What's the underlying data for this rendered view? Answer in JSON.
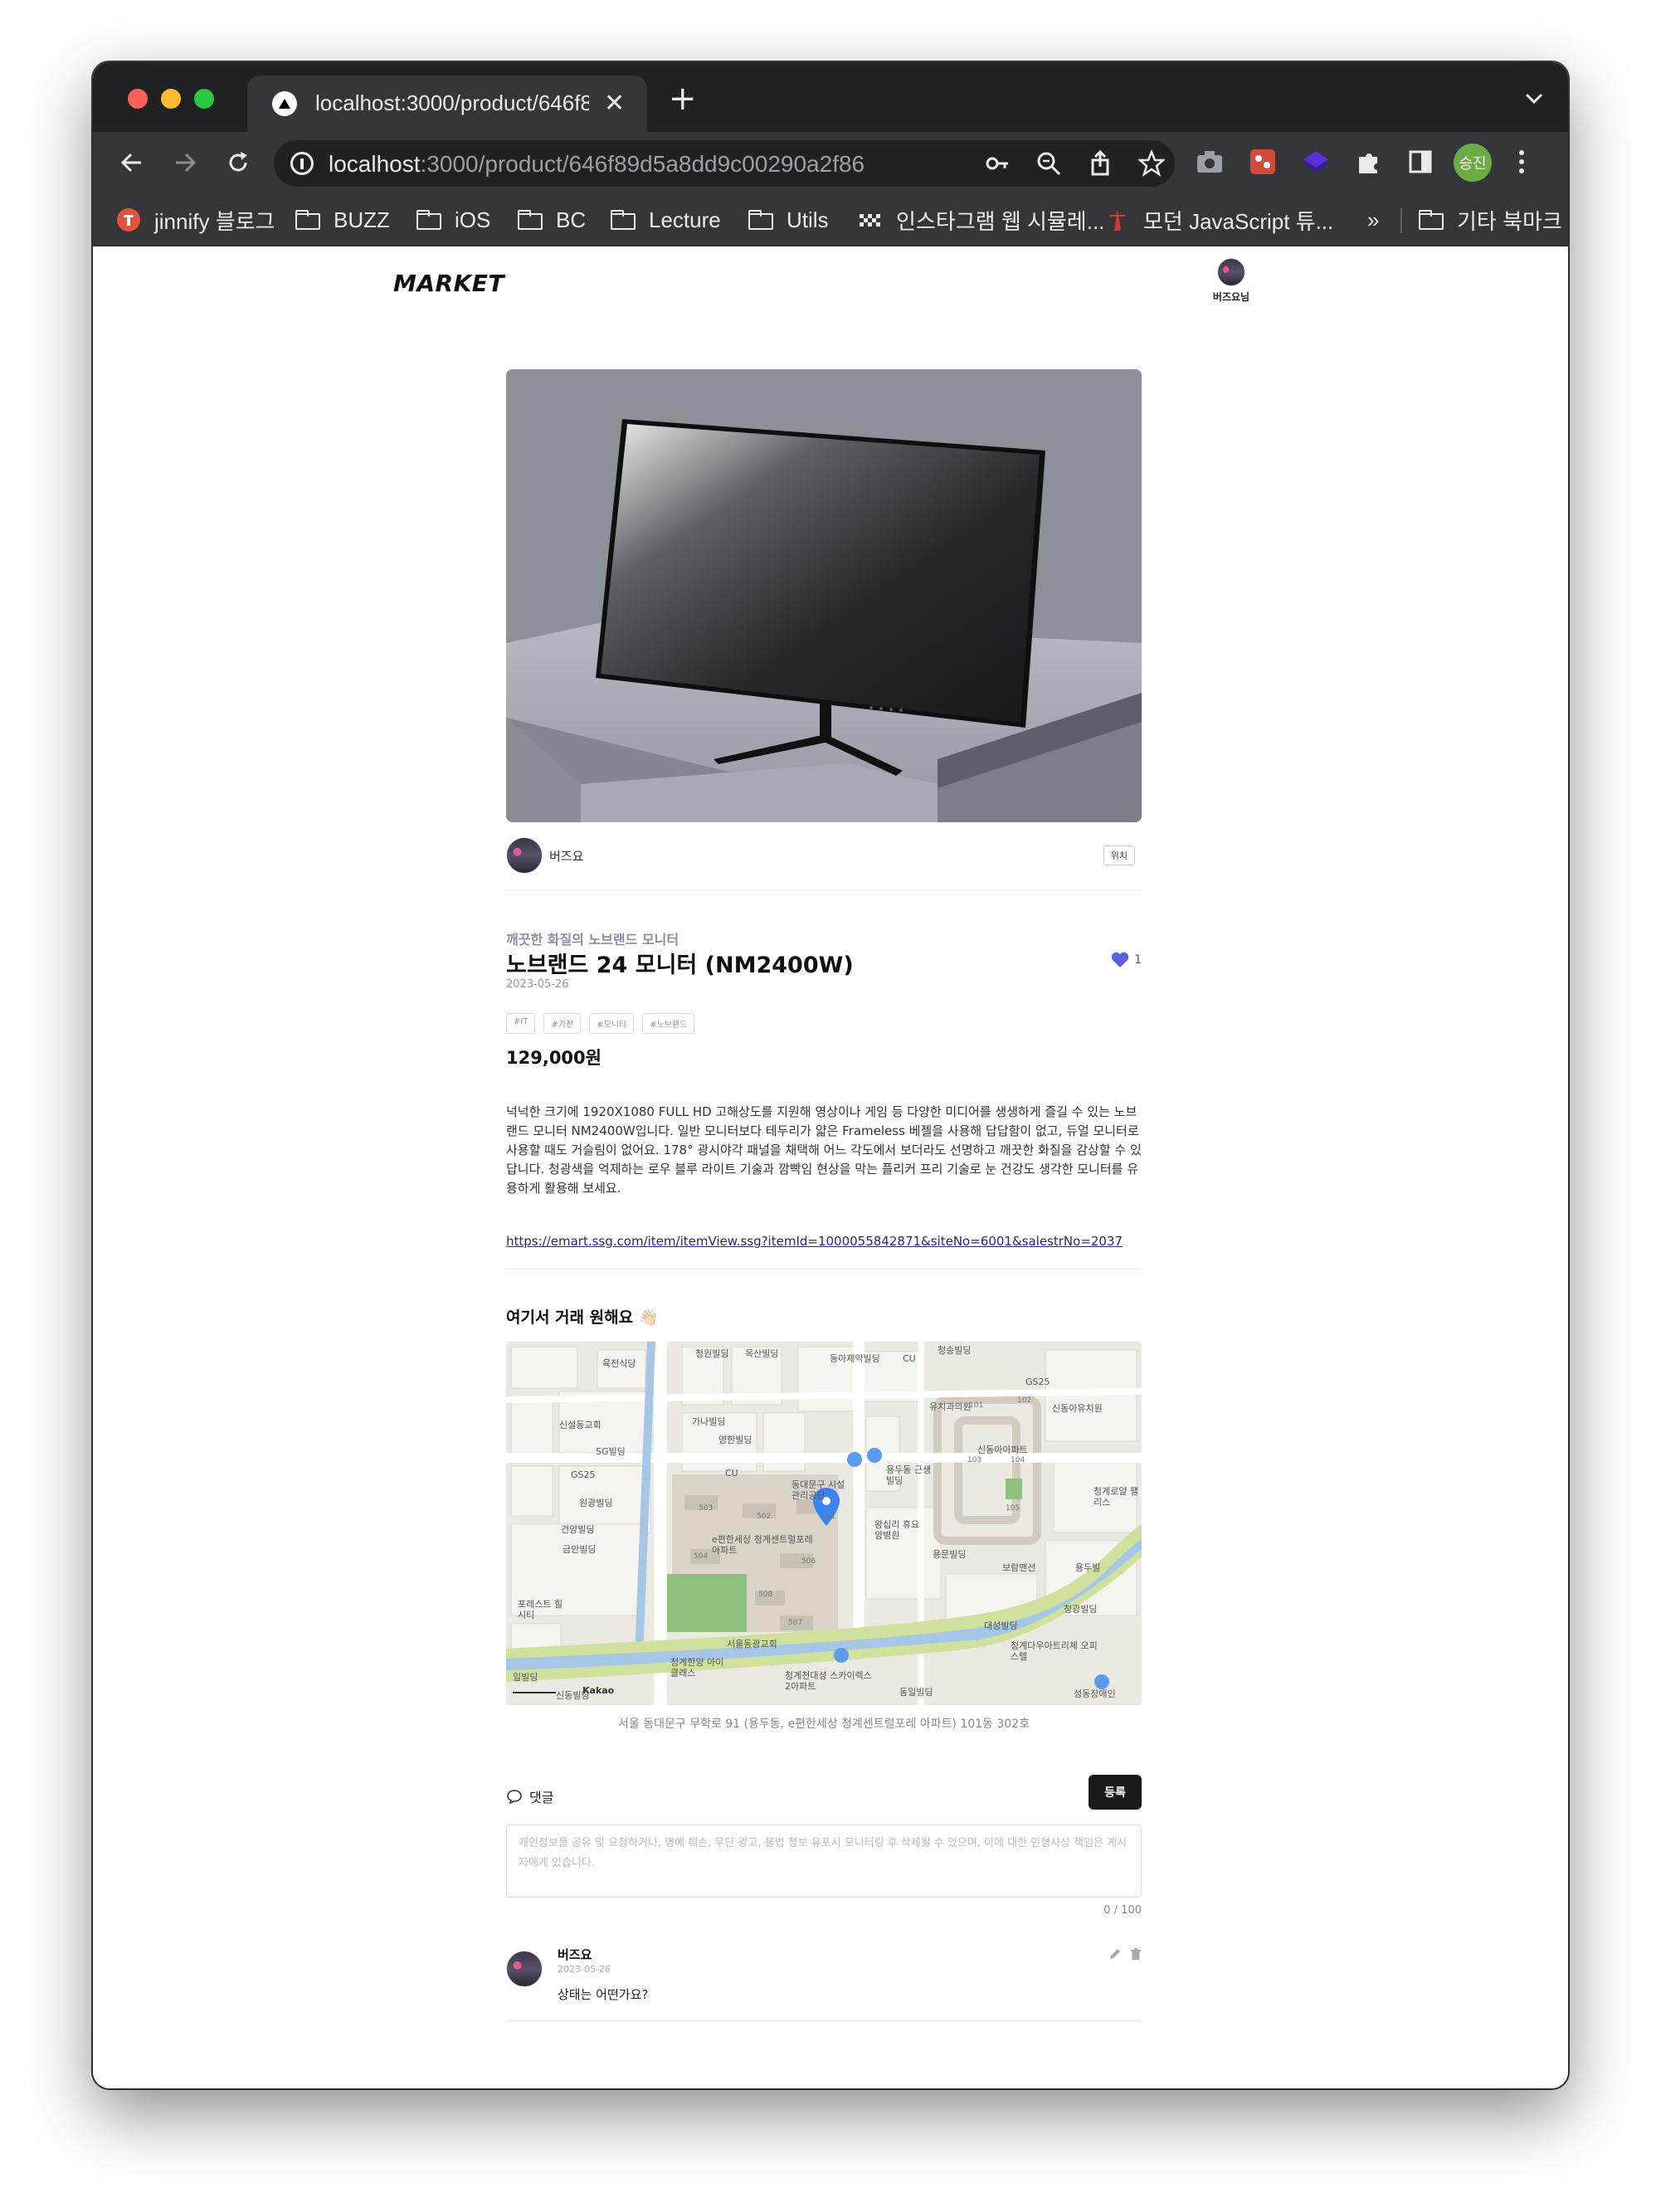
{
  "browser": {
    "tab_title": "localhost:3000/product/646f89d5a8dd9c00290a2f86",
    "url_host": "localhost",
    "url_path": ":3000/product/646f89d5a8dd9c00290a2f86",
    "profile_label": "승진",
    "bookmarks": [
      {
        "label": "jinnify 블로그",
        "icon": "jinnify-favicon"
      },
      {
        "label": "BUZZ",
        "icon": "folder-icon"
      },
      {
        "label": "iOS",
        "icon": "folder-icon"
      },
      {
        "label": "BC",
        "icon": "folder-icon"
      },
      {
        "label": "Lecture",
        "icon": "folder-icon"
      },
      {
        "label": "Utils",
        "icon": "folder-icon"
      },
      {
        "label": "인스타그램 웹 시뮬레...",
        "icon": "checker-favicon"
      },
      {
        "label": "모던 JavaScript 튜...",
        "icon": "tower-favicon"
      }
    ],
    "bookmarks_overflow": "»",
    "other_bookmarks": "기타 북마크"
  },
  "header": {
    "logo": "MARKET",
    "user_name": "버즈요님"
  },
  "product": {
    "seller_name": "버즈요",
    "location_button": "위치",
    "subtitle": "깨끗한 화질의 노브랜드 모니터",
    "title": "노브랜드 24 모니터 (NM2400W)",
    "like_count": "1",
    "date": "2023-05-26",
    "tags": [
      "#IT",
      "#가전",
      "#모니터",
      "#노브랜드"
    ],
    "price": "129,000원",
    "description": "넉넉한 크기에 1920X1080 FULL HD 고해상도를 지원해 영상이나 게임 등 다양한 미디어를 생생하게 즐길 수 있는 노브랜드 모니터 NM2400W입니다. 일반 모니터보다 테두리가 얇은 Frameless 베젤을 사용해 답답함이 없고, 듀얼 모니터로 사용할 때도 거슬림이 없어요. 178° 광시야각 패널을 채택해 어느 각도에서 보더라도 선명하고 깨끗한 화질을 감상할 수 있답니다. 청광색을 억제하는 로우 블루 라이트 기술과 깜빡임 현상을 막는 플리커 프리 기술로 눈 건강도 생각한 모니터를 유용하게 활용해 보세요.",
    "link": "https://emart.ssg.com/item/itemView.ssg?itemId=1000055842871&siteNo=6001&salestrNo=2037"
  },
  "map": {
    "title": "여기서 거래 원해요 👋🏻",
    "address": "서울 동대문구 무학로 91 (용두동, e편한세상 청계센트럴포레 아파트) 101동 302호",
    "labels": [
      "육전식당",
      "청원빌딩",
      "목산빌딩",
      "동아제약빌딩",
      "CU",
      "청송빌딩",
      "유치과의원",
      "GS25",
      "신동아유치원",
      "신설동교회",
      "가나빌딩",
      "SG빌딩",
      "영한빌딩",
      "신동아아파트",
      "GS25",
      "CU",
      "동대문구 시설관리공단",
      "용두동 근생빌딩",
      "청계로얄 팰리스",
      "원광빌딩",
      "건양빌딩",
      "금안빌딩",
      "e편한세상 청계센트럴포레아파트",
      "왕십리 휴요양병원",
      "용문빌딩",
      "보람맨션",
      "용두빌",
      "포레스트 힐시티",
      "서울동광교회",
      "청광빌딩",
      "대성빌딩",
      "청계다우아트리체 오피스텔",
      "청계한양 아이클래스",
      "청계천대성 스카이렉스2아파트",
      "동일빌딩",
      "성동장애인",
      "일빌딩",
      "신동빌딩",
      "Kakao"
    ],
    "building_numbers": [
      "101",
      "102",
      "103",
      "104",
      "105",
      "503",
      "502",
      "504",
      "506",
      "508",
      "507",
      "501"
    ]
  },
  "comments": {
    "header": "댓글",
    "submit": "등록",
    "placeholder": "개인정보를 공유 및 요청하거나, 명예 훼손, 무단 광고, 불법 정보 유포시 모니터링 후 삭제될 수 있으며, 이에 대한 민형사상 책임은 게시자에게 있습니다.",
    "counter": "0 / 100",
    "items": [
      {
        "author": "버즈요",
        "date": "2023-05-26",
        "body": "상태는 어떤가요?"
      }
    ]
  },
  "colors": {
    "like_heart": "#5b5fe0",
    "button_dark": "#1a1a1a",
    "chrome_dark": "#202124",
    "chrome_tab": "#35363a"
  }
}
